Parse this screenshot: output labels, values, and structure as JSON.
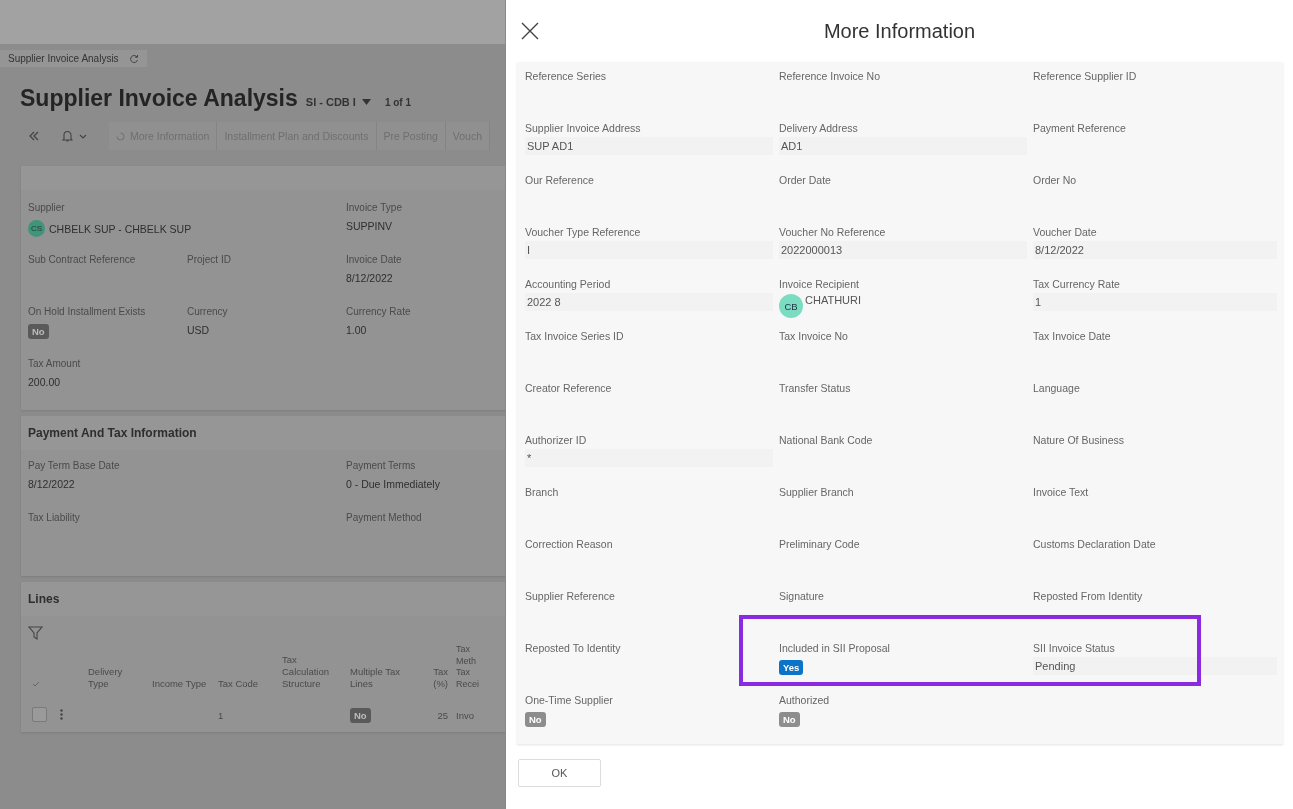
{
  "page": {
    "breadcrumb": "Supplier Invoice Analysis",
    "title": "Supplier Invoice Analysis",
    "record": "SI - CDB I",
    "counter": "1 of 1",
    "toolbar": [
      "More Information",
      "Installment Plan and Discounts",
      "Pre Posting",
      "Vouch"
    ],
    "header_card": {
      "fields": [
        {
          "label": "Supplier",
          "kind": "avatar",
          "initials": "CS",
          "value": "CHBELK SUP - CHBELK SUP"
        },
        {
          "label": "Invoice Type",
          "kind": "text",
          "value": "SUPPINV"
        },
        {
          "label": "Sub Contract Reference",
          "kind": "text"
        },
        {
          "label": "Project ID",
          "kind": "text"
        },
        {
          "label": "Invoice Date",
          "kind": "text",
          "value": "8/12/2022"
        },
        {
          "label": "On Hold Installment Exists",
          "kind": "badge",
          "value": "No",
          "on": false
        },
        {
          "label": "Currency",
          "kind": "text",
          "value": "USD"
        },
        {
          "label": "Currency Rate",
          "kind": "text",
          "value": "1.00"
        },
        {
          "label": "Tax Amount",
          "kind": "text",
          "value": "200.00"
        }
      ]
    },
    "payment_card": {
      "title": "Payment And Tax Information",
      "fields": [
        {
          "label": "Pay Term Base Date",
          "kind": "text",
          "value": "8/12/2022"
        },
        {
          "label": "Payment Terms",
          "kind": "text",
          "value": "0 - Due Immediately"
        },
        {
          "label": "Tax Liability",
          "kind": "text"
        },
        {
          "label": "Payment Method",
          "kind": "text"
        }
      ]
    },
    "lines": {
      "title": "Lines",
      "columns": [
        "Delivery Type",
        "Income Type",
        "Tax Code",
        "Tax Calculation Structure",
        "Multiple Tax Lines",
        "Tax (%)",
        "Tax Meth Tax Recei"
      ],
      "rows": [
        {
          "selected": false,
          "cells": [
            null,
            null,
            "1",
            null,
            {
              "kind": "badge",
              "value": "No",
              "on": false
            },
            "25",
            "Invo"
          ]
        }
      ]
    }
  },
  "dialog": {
    "title": "More Information",
    "fields": [
      {
        "label": "Reference Series",
        "kind": "text"
      },
      {
        "label": "Reference Invoice No",
        "kind": "text"
      },
      {
        "label": "Reference Supplier ID",
        "kind": "text"
      },
      {
        "label": "Supplier Invoice Address",
        "kind": "text",
        "value": "SUP AD1"
      },
      {
        "label": "Delivery Address",
        "kind": "text",
        "value": "AD1"
      },
      {
        "label": "Payment Reference",
        "kind": "text"
      },
      {
        "label": "Our Reference",
        "kind": "text"
      },
      {
        "label": "Order Date",
        "kind": "text"
      },
      {
        "label": "Order No",
        "kind": "text"
      },
      {
        "label": "Voucher Type Reference",
        "kind": "text",
        "value": "I"
      },
      {
        "label": "Voucher No Reference",
        "kind": "text",
        "value": "2022000013"
      },
      {
        "label": "Voucher Date",
        "kind": "text",
        "value": "8/12/2022"
      },
      {
        "label": "Accounting Period",
        "kind": "text",
        "value": "2022  8"
      },
      {
        "label": "Invoice Recipient",
        "kind": "avatar",
        "initials": "CB",
        "value": "CHATHURI"
      },
      {
        "label": "Tax Currency Rate",
        "kind": "text",
        "value": "1"
      },
      {
        "label": "Tax Invoice Series ID",
        "kind": "text"
      },
      {
        "label": "Tax Invoice No",
        "kind": "text"
      },
      {
        "label": "Tax Invoice Date",
        "kind": "text"
      },
      {
        "label": "Creator Reference",
        "kind": "text"
      },
      {
        "label": "Transfer Status",
        "kind": "text"
      },
      {
        "label": "Language",
        "kind": "text"
      },
      {
        "label": "Authorizer ID",
        "kind": "text",
        "value": "*"
      },
      {
        "label": "National Bank Code",
        "kind": "text"
      },
      {
        "label": "Nature Of Business",
        "kind": "text"
      },
      {
        "label": "Branch",
        "kind": "text"
      },
      {
        "label": "Supplier Branch",
        "kind": "text"
      },
      {
        "label": "Invoice Text",
        "kind": "text"
      },
      {
        "label": "Correction Reason",
        "kind": "text"
      },
      {
        "label": "Preliminary Code",
        "kind": "text"
      },
      {
        "label": "Customs Declaration Date",
        "kind": "text"
      },
      {
        "label": "Supplier Reference",
        "kind": "text"
      },
      {
        "label": "Signature",
        "kind": "text"
      },
      {
        "label": "Reposted From Identity",
        "kind": "text"
      },
      {
        "label": "Reposted To Identity",
        "kind": "text"
      },
      {
        "label": "Included in SII Proposal",
        "kind": "badge",
        "value": "Yes",
        "on": true
      },
      {
        "label": "SII Invoice Status",
        "kind": "text",
        "value": "Pending"
      },
      {
        "label": "One-Time Supplier",
        "kind": "badge",
        "value": "No",
        "on": false
      },
      {
        "label": "Authorized",
        "kind": "badge",
        "value": "No",
        "on": false
      }
    ],
    "buttons": [
      "OK"
    ]
  }
}
